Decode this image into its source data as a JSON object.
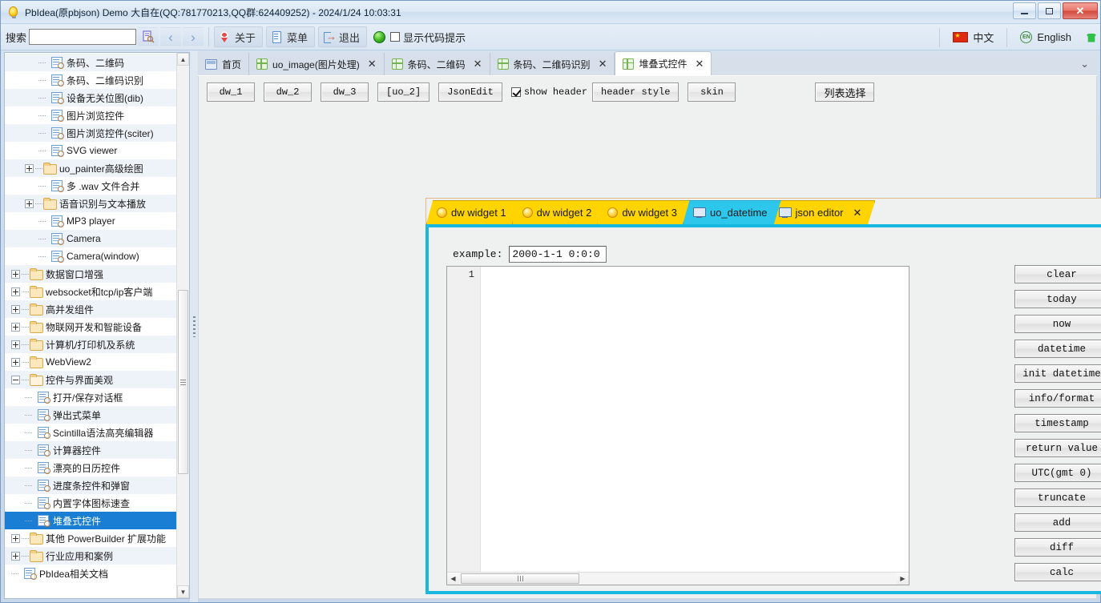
{
  "window": {
    "title": "PbIdea(原pbjson) Demo 大自在(QQ:781770213,QQ群:624409252) - 2024/1/24 10:03:31",
    "icon": "lightbulb-icon",
    "controls": {
      "minimize": "–",
      "maximize": "❐",
      "close": "✕"
    }
  },
  "toolbar": {
    "search_label": "搜索",
    "search_value": "",
    "search_placeholder": "",
    "find_icon": "document-search-icon",
    "prev_icon": "chevron-left-icon",
    "next_icon": "chevron-right-icon",
    "about_label": "关于",
    "menu_label": "菜单",
    "exit_label": "退出",
    "status_orb": "green-orb-icon",
    "code_hint_label": "显示代码提示",
    "code_hint_checked": false,
    "lang_cn": "中文",
    "lang_en": "English",
    "skin_icon": "tshirt-icon"
  },
  "tree": {
    "items": [
      {
        "label": "条码、二维码",
        "depth": 3,
        "type": "leaf"
      },
      {
        "label": "条码、二维码识别",
        "depth": 3,
        "type": "leaf"
      },
      {
        "label": "设备无关位图(dib)",
        "depth": 3,
        "type": "leaf"
      },
      {
        "label": "图片浏览控件",
        "depth": 3,
        "type": "leaf"
      },
      {
        "label": "图片浏览控件(sciter)",
        "depth": 3,
        "type": "leaf"
      },
      {
        "label": "SVG viewer",
        "depth": 3,
        "type": "leaf"
      },
      {
        "label": "uo_painter高级绘图",
        "depth": 2,
        "type": "folder",
        "expander": "plus"
      },
      {
        "label": "多 .wav 文件合并",
        "depth": 3,
        "type": "leaf"
      },
      {
        "label": "语音识别与文本播放",
        "depth": 2,
        "type": "folder",
        "expander": "plus"
      },
      {
        "label": "MP3 player",
        "depth": 3,
        "type": "leaf"
      },
      {
        "label": "Camera",
        "depth": 3,
        "type": "leaf"
      },
      {
        "label": "Camera(window)",
        "depth": 3,
        "type": "leaf"
      },
      {
        "label": "数据窗口增强",
        "depth": 1,
        "type": "folder",
        "expander": "plus"
      },
      {
        "label": "websocket和tcp/ip客户端",
        "depth": 1,
        "type": "folder",
        "expander": "plus"
      },
      {
        "label": "高并发组件",
        "depth": 1,
        "type": "folder",
        "expander": "plus"
      },
      {
        "label": "物联网开发和智能设备",
        "depth": 1,
        "type": "folder",
        "expander": "plus"
      },
      {
        "label": "计算机/打印机及系统",
        "depth": 1,
        "type": "folder",
        "expander": "plus"
      },
      {
        "label": "WebView2",
        "depth": 1,
        "type": "folder",
        "expander": "plus"
      },
      {
        "label": "控件与界面美观",
        "depth": 1,
        "type": "folder",
        "expander": "minus",
        "open": true
      },
      {
        "label": "打开/保存对话框",
        "depth": 2,
        "type": "leaf"
      },
      {
        "label": "弹出式菜单",
        "depth": 2,
        "type": "leaf"
      },
      {
        "label": "Scintilla语法高亮编辑器",
        "depth": 2,
        "type": "leaf"
      },
      {
        "label": "计算器控件",
        "depth": 2,
        "type": "leaf"
      },
      {
        "label": "漂亮的日历控件",
        "depth": 2,
        "type": "leaf"
      },
      {
        "label": "进度条控件和弹窗",
        "depth": 2,
        "type": "leaf"
      },
      {
        "label": "内置字体图标速查",
        "depth": 2,
        "type": "leaf"
      },
      {
        "label": "堆叠式控件",
        "depth": 2,
        "type": "leaf",
        "selected": true
      },
      {
        "label": "其他 PowerBuilder 扩展功能",
        "depth": 1,
        "type": "folder",
        "expander": "plus"
      },
      {
        "label": "行业应用和案例",
        "depth": 1,
        "type": "folder",
        "expander": "plus"
      },
      {
        "label": "PbIdea相关文档",
        "depth": 1,
        "type": "leaf"
      }
    ],
    "scroll_up_icon": "scroll-up-arrow-icon",
    "scroll_down_icon": "scroll-down-arrow-icon"
  },
  "tabs": {
    "items": [
      {
        "label": "首页",
        "icon": "home-icon",
        "closable": false,
        "active": false
      },
      {
        "label": "uo_image(图片处理)",
        "icon": "grid-icon",
        "closable": true,
        "active": false
      },
      {
        "label": "条码、二维码",
        "icon": "grid-icon",
        "closable": true,
        "active": false
      },
      {
        "label": "条码、二维码识别",
        "icon": "grid-icon",
        "closable": true,
        "active": false
      },
      {
        "label": "堆叠式控件",
        "icon": "grid-icon",
        "closable": true,
        "active": true
      }
    ],
    "close_glyph": "✕",
    "overflow_icon": "chevron-down-icon"
  },
  "dwbar": {
    "buttons": [
      "dw_1",
      "dw_2",
      "dw_3",
      "[uo_2]",
      "JsonEdit"
    ],
    "show_header_label": "show header",
    "show_header_checked": true,
    "header_style_label": "header style",
    "skin_label": "skin",
    "list_select_label": "列表选择"
  },
  "inner_tabs": {
    "items": [
      {
        "label": "dw widget 1",
        "icon": "lightbulb-icon",
        "style": "yellow",
        "closable": false
      },
      {
        "label": "dw widget 2",
        "icon": "lightbulb-icon",
        "style": "yellow",
        "closable": false
      },
      {
        "label": "dw widget 3",
        "icon": "lightbulb-icon",
        "style": "yellow",
        "closable": false
      },
      {
        "label": "uo_datetime",
        "icon": "monitor-icon",
        "style": "cyan",
        "closable": false,
        "active": true
      },
      {
        "label": "json editor",
        "icon": "monitor-icon",
        "style": "yellow",
        "closable": true
      }
    ],
    "close_glyph": "✕",
    "overflow_icon": "triangle-down-icon"
  },
  "panel": {
    "example_label": "example:",
    "example_value": "2000-1-1 0:0:0",
    "editor_line_number": "1",
    "editor_text": "",
    "hscroll_left_icon": "scroll-left-arrow-icon",
    "hscroll_right_icon": "scroll-right-arrow-icon",
    "buttons": [
      "clear",
      "today",
      "now",
      "datetime",
      "init datetime",
      "info/format",
      "timestamp",
      "return value",
      "UTC(gmt 0)",
      "truncate",
      "add",
      "diff",
      "calc"
    ]
  },
  "colors": {
    "accent_cyan": "#18b8e0",
    "tab_yellow": "#ffd400",
    "selection_blue": "#1a7fd4",
    "close_red": "#d2493c"
  }
}
